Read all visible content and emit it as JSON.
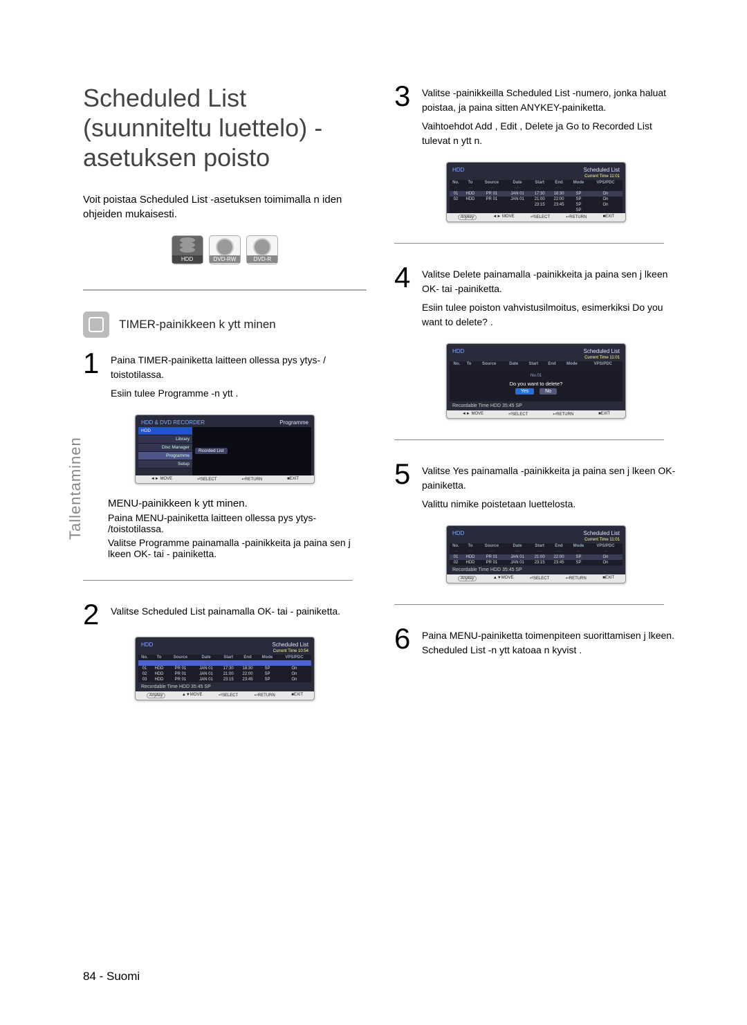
{
  "title": "Scheduled List (suunniteltu luettelo) - asetuksen poisto",
  "intro": "Voit poistaa Scheduled List -asetuksen toimimalla n iden ohjeiden mukaisesti.",
  "media": {
    "hdd": "HDD",
    "rw": "DVD-RW",
    "r": "DVD-R"
  },
  "side_tab": "Tallentaminen",
  "sub_heading": "TIMER-painikkeen k ytt minen",
  "steps": {
    "s1a": "Paina TIMER-painiketta laitteen ollessa pys ytys- / toistotilassa.",
    "s1b": "Esiin tulee Programme -n ytt .",
    "menu_heading": "MENU-painikkeen k ytt minen.",
    "menu_a": "Paina MENU-painiketta laitteen ollessa pys ytys- /toistotilassa.",
    "menu_b": "Valitse Programme  painamalla          -painikkeita ja paina sen j lkeen OK- tai   -   painiketta.",
    "s2": "Valitse Scheduled List   painamalla OK- tai   - painiketta.",
    "s3a": "Valitse         -painikkeilla Scheduled List -numero, jonka haluat poistaa, ja paina sitten ANYKEY-painiketta.",
    "s3b": "Vaihtoehdot Add , Edit , Delete  ja Go to Recorded List   tulevat n ytt  n.",
    "s4a": "Valitse Delete  painamalla          -painikkeita ja paina sen j lkeen  OK- tai    -painiketta.",
    "s4b": "Esiin tulee poiston vahvistusilmoitus, esimerkiksi  Do you want to delete? .",
    "s5a": "Valitse Yes painamalla          -painikkeita ja paina sen j lkeen  OK-painiketta.",
    "s5b": "Valittu nimike poistetaan luettelosta.",
    "s6": "Paina MENU-painiketta toimenpiteen suorittamisen j lkeen. Scheduled List -n ytt  katoaa n kyvist ."
  },
  "osd_menu": {
    "header_left": "HDD & DVD RECORDER",
    "header_right": "Programme",
    "side_items": [
      "HDD",
      "Library",
      "Disc Manager",
      "Programme",
      "Setup"
    ],
    "main_item": "Rcorded List"
  },
  "osd_list": {
    "title_left": "HDD",
    "title_right": "Scheduled List",
    "time_label": "Current Time",
    "time_1": "10:54",
    "time_2": "11:01",
    "cols": [
      "No.",
      "To",
      "Source",
      "Date",
      "Start",
      "End",
      "Mode",
      "VPS/PDC"
    ],
    "blank_row": [
      "--",
      "---",
      "----",
      "--/--",
      "--:--",
      "--:--",
      "--",
      "--"
    ],
    "rows": [
      [
        "01",
        "HDD",
        "PR 01",
        "JAN 01",
        "17:30",
        "18:30",
        "SP",
        "On"
      ],
      [
        "02",
        "HDD",
        "PR 01",
        "JAN 01",
        "21:00",
        "22:00",
        "SP",
        "On"
      ],
      [
        "03",
        "HDD",
        "PR 01",
        "JAN 01",
        "23:15",
        "23:45",
        "SP",
        "On"
      ]
    ],
    "rows_step3_extra": [
      "",
      "",
      "",
      "",
      "23:15",
      "23:45",
      "SP",
      "On"
    ],
    "rows_step5": [
      [
        "01",
        "HDD",
        "PR 01",
        "JAN 01",
        "21:00",
        "22:00",
        "SP",
        "On"
      ],
      [
        "02",
        "HDD",
        "PR 01",
        "JAN 01",
        "23:15",
        "23:45",
        "SP",
        "On"
      ]
    ],
    "rec_time": "Recordable Time     HDD  35:45 SP",
    "sp_only": "SP"
  },
  "osd_confirm": {
    "no1": "No.01",
    "question": "Do you want to delete?",
    "yes": "Yes",
    "no": "No"
  },
  "osd_footer": {
    "anykey": "Anykey",
    "move": "MOVE",
    "move2": "MOVE",
    "select": "SELECT",
    "return": "RETURN",
    "exit": "EXIT"
  },
  "footer": "84 - Suomi"
}
